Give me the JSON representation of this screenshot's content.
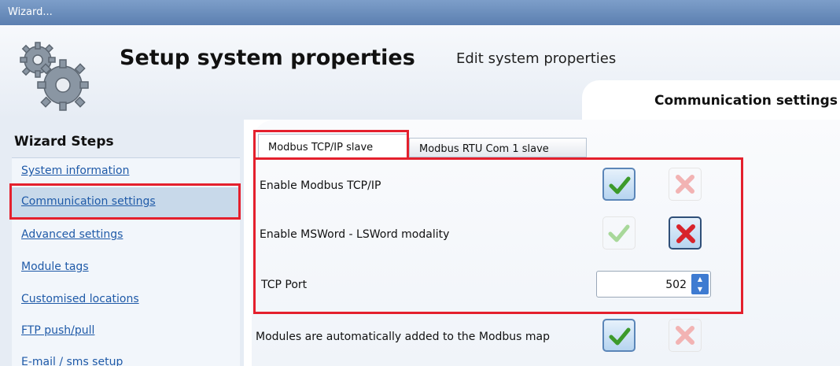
{
  "window": {
    "title": "Wizard..."
  },
  "header": {
    "title": "Setup system properties",
    "subtitle": "Edit system properties",
    "page_tab": "Communication settings"
  },
  "wizard": {
    "title": "Wizard Steps",
    "steps": [
      {
        "label": "System information"
      },
      {
        "label": "Communication settings",
        "active": true
      },
      {
        "label": "Advanced settings"
      },
      {
        "label": "Module tags"
      },
      {
        "label": "Customised locations"
      },
      {
        "label": "FTP push/pull"
      },
      {
        "label": "E-mail / sms setup"
      }
    ]
  },
  "tabs": [
    {
      "label": "Modbus TCP/IP slave",
      "selected": true
    },
    {
      "label": "Modbus RTU Com 1 slave",
      "selected": false
    }
  ],
  "settings": {
    "enable_modbus": {
      "label": "Enable Modbus TCP/IP",
      "value": "enabled"
    },
    "enable_msword": {
      "label": "Enable MSWord - LSWord modality",
      "value": "disabled"
    },
    "tcp_port": {
      "label": "TCP Port",
      "value": "502"
    },
    "auto_modules": {
      "label": "Modules are automatically added to the Modbus map",
      "value": "enabled"
    }
  },
  "colors": {
    "highlight_red": "#e4202d",
    "link_blue": "#1f5aa8",
    "check_green": "#3c9a2b",
    "cross_red": "#d8242b"
  }
}
